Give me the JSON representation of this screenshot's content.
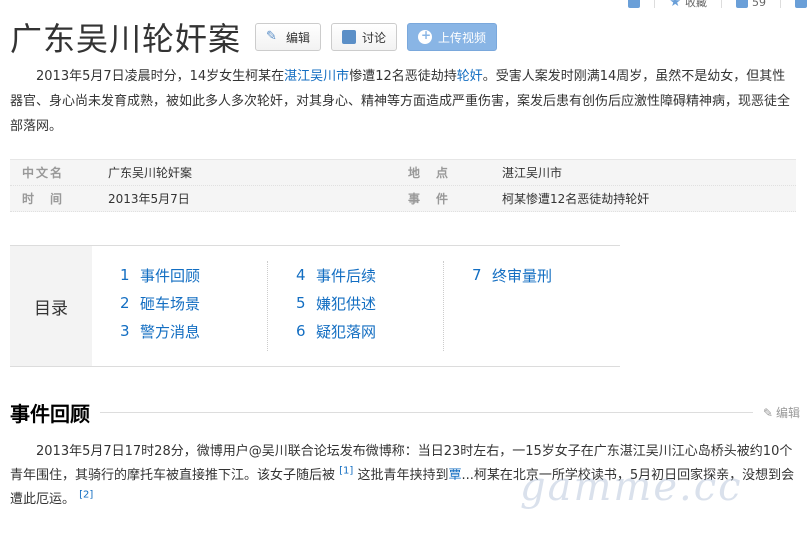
{
  "top_actions": {
    "collect_label": "收藏",
    "share_count": "59"
  },
  "title": "广东吴川轮奸案",
  "buttons": {
    "edit": "编辑",
    "discuss": "讨论",
    "upload": "上传视频"
  },
  "summary": {
    "p1": "2013年5月7日凌晨时分，14岁女生柯某在",
    "link1": "湛江吴川市",
    "p2": "惨遭12名恶徒劫持",
    "link2": "轮奸",
    "p3": "。受害人案发时刚满14周岁，虽然不是幼女，但其性器官、身心尚未发育成熟，被如此多人多次轮奸，对其身心、精神等方面造成严重伤害，案发后患有创伤后应激性障碍精神病，现恶徒全部落网。"
  },
  "info": [
    {
      "k1": "中文名",
      "v1": "广东吴川轮奸案",
      "k2": "地　点",
      "v2": "湛江吴川市"
    },
    {
      "k1": "时　间",
      "v1": "2013年5月7日",
      "k2": "事　件",
      "v2": "柯某惨遭12名恶徒劫持轮奸"
    }
  ],
  "catalog": {
    "label": "目录",
    "columns": [
      [
        {
          "num": "1",
          "text": "事件回顾"
        },
        {
          "num": "2",
          "text": "砸车场景"
        },
        {
          "num": "3",
          "text": "警方消息"
        }
      ],
      [
        {
          "num": "4",
          "text": "事件后续"
        },
        {
          "num": "5",
          "text": "嫌犯供述"
        },
        {
          "num": "6",
          "text": "疑犯落网"
        }
      ],
      [
        {
          "num": "7",
          "text": "终审量刑"
        }
      ]
    ]
  },
  "section": {
    "title": "事件回顾",
    "edit": "编辑",
    "t1": "2013年5月7日17时28分，微博用户@吴川联合论坛发布微博称：当日23时左右，一15岁女子在广东湛江吴川江心岛桥头被约10个青年围住，其骑行的摩托车被直接推下江。该女子随后被",
    "ref1": "[1]",
    "t2": "这批青年挟持到",
    "link": "覃",
    "t3": "...",
    "t4": "柯某在北京一所学校读书，5月初日回家探亲，没想到会遭此厄运。",
    "ref2": "[2]"
  },
  "watermark": "gamme.cc"
}
